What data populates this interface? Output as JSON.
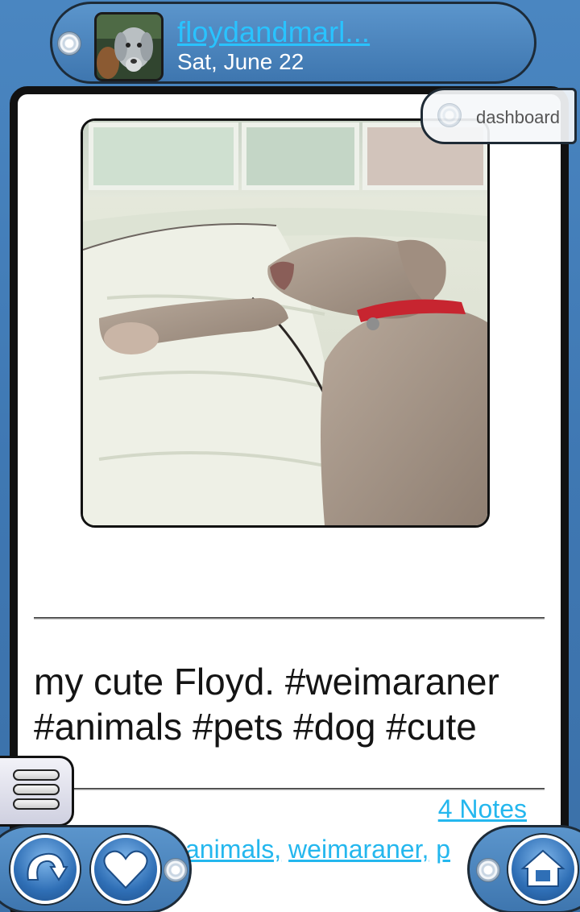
{
  "header": {
    "blog_name": "floydandmarl...",
    "date": "Sat, June 22"
  },
  "post": {
    "caption": "my cute Floyd. #weimaraner #animals #pets #dog #cute",
    "notes": "4 Notes",
    "tags": [
      "animals,",
      "weimaraner,",
      "p"
    ]
  },
  "dashboard_tab": {
    "label": "dashboard"
  },
  "icons": {
    "reblog": "reblog-arrow-icon",
    "like": "heart-icon",
    "home": "home-icon",
    "menu": "menu-stack-icon"
  },
  "colors": {
    "link": "#24b7ee",
    "header_link": "#29c3ff",
    "accent_blue": "#3e76af"
  }
}
